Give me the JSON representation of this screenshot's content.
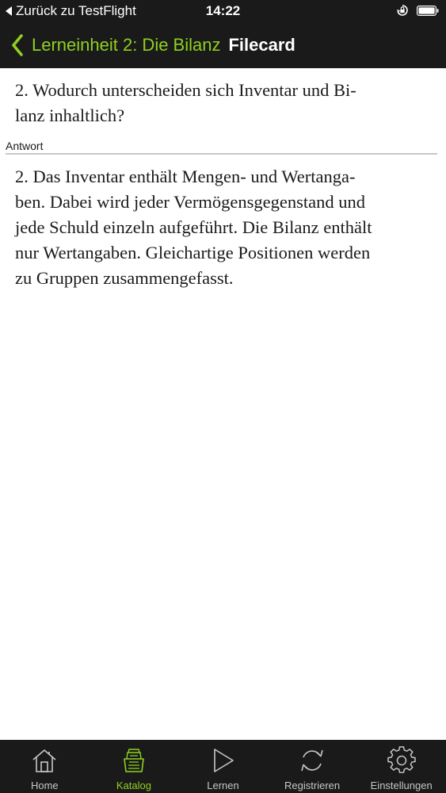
{
  "status_bar": {
    "back_text": "Zurück zu TestFlight",
    "time": "14:22",
    "icons": [
      "back-triangle-icon",
      "orientation-lock-icon",
      "battery-icon"
    ]
  },
  "nav_bar": {
    "back_label": "Lerneinheit 2: Die Bilanz",
    "title": "Filecard",
    "back_icon": "chevron-left-icon"
  },
  "card": {
    "question": "2. Wodurch unterscheiden sich Inventar und Bi-\nlanz inhaltlich?",
    "answer_label": "Antwort",
    "answer": "2. Das Inventar enthält Mengen- und Wertanga-\nben. Dabei wird jeder Vermögensgegenstand und\njede Schuld einzeln aufgeführt. Die Bilanz enthält\nnur Wertangaben. Gleichartige Positionen werden\nzu Gruppen zusammengefasst."
  },
  "tab_bar": {
    "active": "Katalog",
    "tabs": [
      {
        "label": "Home",
        "icon": "home-icon"
      },
      {
        "label": "Katalog",
        "icon": "catalog-icon"
      },
      {
        "label": "Lernen",
        "icon": "play-icon"
      },
      {
        "label": "Registrieren",
        "icon": "refresh-icon"
      },
      {
        "label": "Einstellungen",
        "icon": "gear-icon"
      }
    ]
  },
  "colors": {
    "accent": "#8fd11e",
    "bar_background": "#1a1a1a",
    "tab_inactive": "#c7c7c7"
  }
}
